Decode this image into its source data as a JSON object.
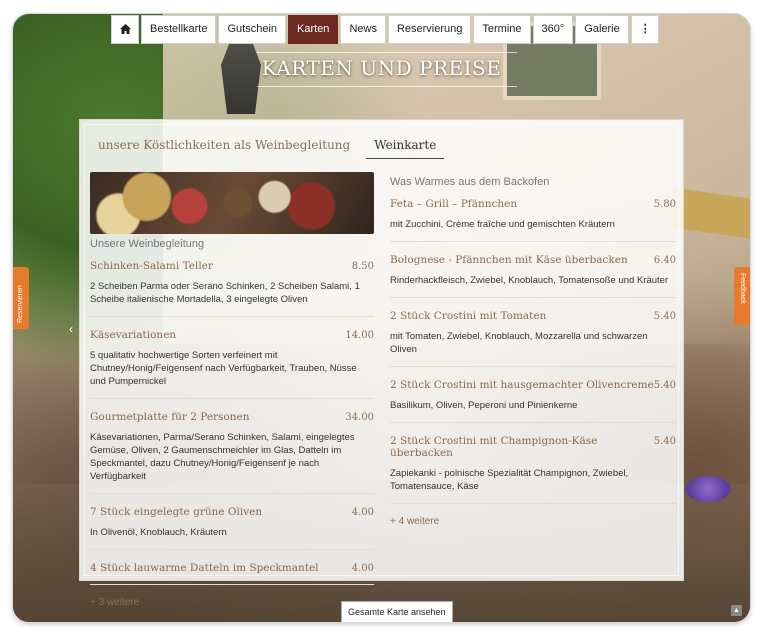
{
  "nav": {
    "home_icon": "home-icon",
    "items": [
      "Bestellkarte",
      "Gutschein",
      "Karten",
      "News",
      "Reservierung",
      "Termine",
      "360°",
      "Galerie"
    ],
    "active": "Karten",
    "more_icon": "⋮"
  },
  "page": {
    "title": "KARTEN UND PREISE"
  },
  "tabs": [
    "unsere Köstlichkeiten als Weinbegleitung",
    "Weinkarte"
  ],
  "left": {
    "section": "Unsere Weinbegleitung",
    "items": [
      {
        "name": "Schinken-Salami Teller",
        "price": "8.50",
        "desc": "2 Scheiben Parma oder Serano Schinken, 2 Scheiben Salami, 1 Scheibe italienische Mortadella, 3 eingelegte Oliven"
      },
      {
        "name": "Käsevariationen",
        "price": "14.00",
        "desc": "5 qualitativ hochwertige Sorten verfeinert mit Chutney/Honig/Feigensenf nach Verfügbarkeit, Trauben, Nüsse und Pumpernickel"
      },
      {
        "name": "Gourmetplatte für 2 Personen",
        "price": "34.00",
        "desc": "Käsevariationen, Parma/Serano Schinken, Salami, eingelegtes Gemüse, Oliven, 2 Gaumenschmeichler im Glas, Datteln im Speckmantel, dazu Chutney/Honig/Feigensenf je nach Verfügbarkeit"
      },
      {
        "name": "7 Stück eingelegte grüne Oliven",
        "price": "4.00",
        "desc": "In Olivenöl, Knoblauch, Kräutern"
      },
      {
        "name": "4 Stück lauwarme Datteln im Speckmantel",
        "price": "4.00",
        "desc": ""
      }
    ],
    "more": "+ 3 weitere"
  },
  "right": {
    "section": "Was Warmes aus dem Backofen",
    "items": [
      {
        "name": "Feta – Grill – Pfännchen",
        "price": "5.80",
        "desc": "mit Zucchini, Crème fraîche und gemischten Kräutern"
      },
      {
        "name": "Bolognese - Pfännchen mit Käse überbacken",
        "price": "6.40",
        "desc": "Rinderhackfleisch, Zwiebel, Knoblauch, Tomatensoße und Kräuter"
      },
      {
        "name": "2 Stück Crostini mit Tomaten",
        "price": "5.40",
        "desc": "mit Tomaten, Zwiebel, Knoblauch, Mozzarella und schwarzen Oliven"
      },
      {
        "name": "2 Stück Crostini mit hausgemachter Olivencreme",
        "price": "5.40",
        "desc": "Basilikum, Oliven, Peperoni und Pinienkerne"
      },
      {
        "name": "2 Stück Crostini mit Champignon-Käse überbacken",
        "price": "5.40",
        "desc": "Zapiekanki - polnische Spezialität Champignon, Zwiebel, Tomatensauce, Käse"
      }
    ],
    "more": "+ 4 weitere"
  },
  "footer": {
    "button": "Gesamte Karte ansehen"
  },
  "side": {
    "left_label": "Reservieren",
    "right_label": "Feedback"
  },
  "colors": {
    "accent": "#6d2a20",
    "side_tab": "#e77a2b",
    "item_name": "#8a6a4c"
  }
}
